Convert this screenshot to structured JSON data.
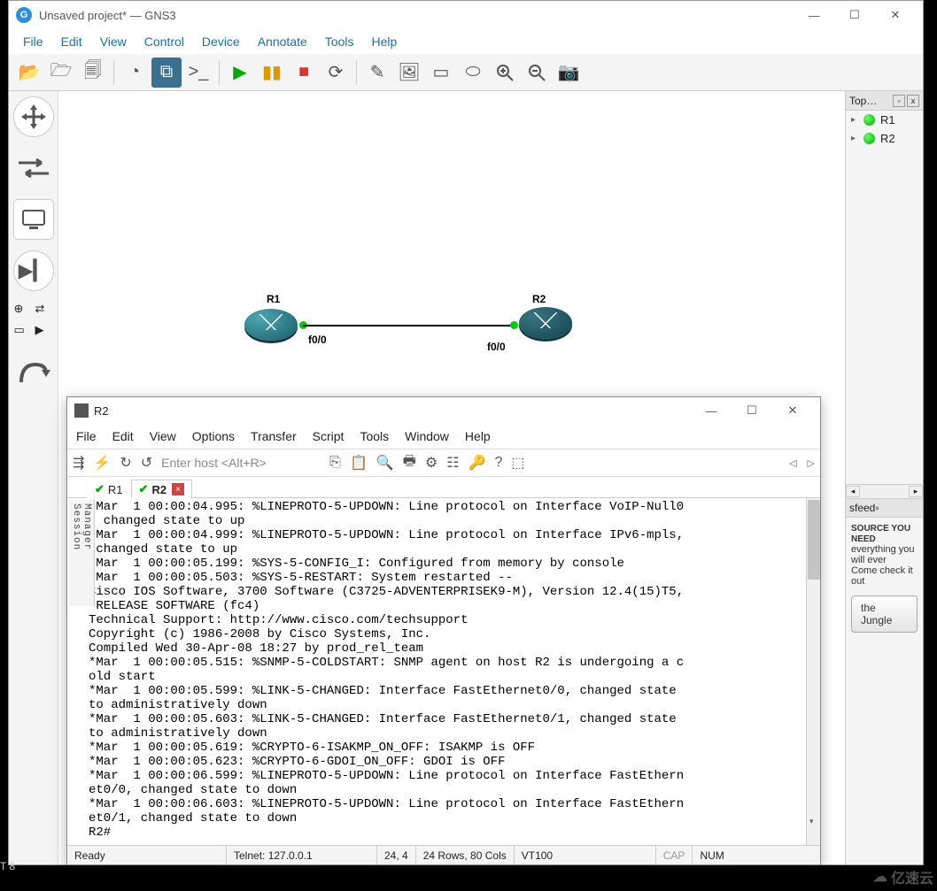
{
  "window": {
    "title": "Unsaved project* — GNS3",
    "menus": [
      "File",
      "Edit",
      "View",
      "Control",
      "Device",
      "Annotate",
      "Tools",
      "Help"
    ]
  },
  "topology": {
    "panel_title": "Top…",
    "items": [
      "R1",
      "R2"
    ]
  },
  "canvas": {
    "r1": {
      "label": "R1",
      "port": "f0/0"
    },
    "r2": {
      "label": "R2",
      "port": "f0/0"
    }
  },
  "feed": {
    "header": "sfeed",
    "headline": "SOURCE YOU NEED",
    "line1": "everything you will ever",
    "line2": "Come check it out",
    "button": "the Jungle"
  },
  "terminal": {
    "title": "R2",
    "menus": [
      "File",
      "Edit",
      "View",
      "Options",
      "Transfer",
      "Script",
      "Tools",
      "Window",
      "Help"
    ],
    "host_placeholder": "Enter host <Alt+R>",
    "session_manager": "Session Manager",
    "tabs": [
      {
        "label": "R1",
        "active": false
      },
      {
        "label": "R2",
        "active": true
      }
    ],
    "output": "*Mar  1 00:00:04.995: %LINEPROTO-5-UPDOWN: Line protocol on Interface VoIP-Null0\n, changed state to up\n*Mar  1 00:00:04.999: %LINEPROTO-5-UPDOWN: Line protocol on Interface IPv6-mpls,\n changed state to up\n*Mar  1 00:00:05.199: %SYS-5-CONFIG_I: Configured from memory by console\n*Mar  1 00:00:05.503: %SYS-5-RESTART: System restarted --\nCisco IOS Software, 3700 Software (C3725-ADVENTERPRISEK9-M), Version 12.4(15)T5,\n RELEASE SOFTWARE (fc4)\nTechnical Support: http://www.cisco.com/techsupport\nCopyright (c) 1986-2008 by Cisco Systems, Inc.\nCompiled Wed 30-Apr-08 18:27 by prod_rel_team\n*Mar  1 00:00:05.515: %SNMP-5-COLDSTART: SNMP agent on host R2 is undergoing a c\nold start\n*Mar  1 00:00:05.599: %LINK-5-CHANGED: Interface FastEthernet0/0, changed state \nto administratively down\n*Mar  1 00:00:05.603: %LINK-5-CHANGED: Interface FastEthernet0/1, changed state \nto administratively down\n*Mar  1 00:00:05.619: %CRYPTO-6-ISAKMP_ON_OFF: ISAKMP is OFF\n*Mar  1 00:00:05.623: %CRYPTO-6-GDOI_ON_OFF: GDOI is OFF\n*Mar  1 00:00:06.599: %LINEPROTO-5-UPDOWN: Line protocol on Interface FastEthern\net0/0, changed state to down\n*Mar  1 00:00:06.603: %LINEPROTO-5-UPDOWN: Line protocol on Interface FastEthern\net0/1, changed state to down\nR2#",
    "status_ready": "Ready",
    "status_conn": "Telnet: 127.0.0.1",
    "status_pos": "24,  4",
    "status_size": "24 Rows, 80 Cols",
    "status_emu": "VT100",
    "status_cap": "CAP",
    "status_num": "NUM"
  },
  "outside": {
    "t8": "T 8"
  },
  "watermark": "亿速云"
}
